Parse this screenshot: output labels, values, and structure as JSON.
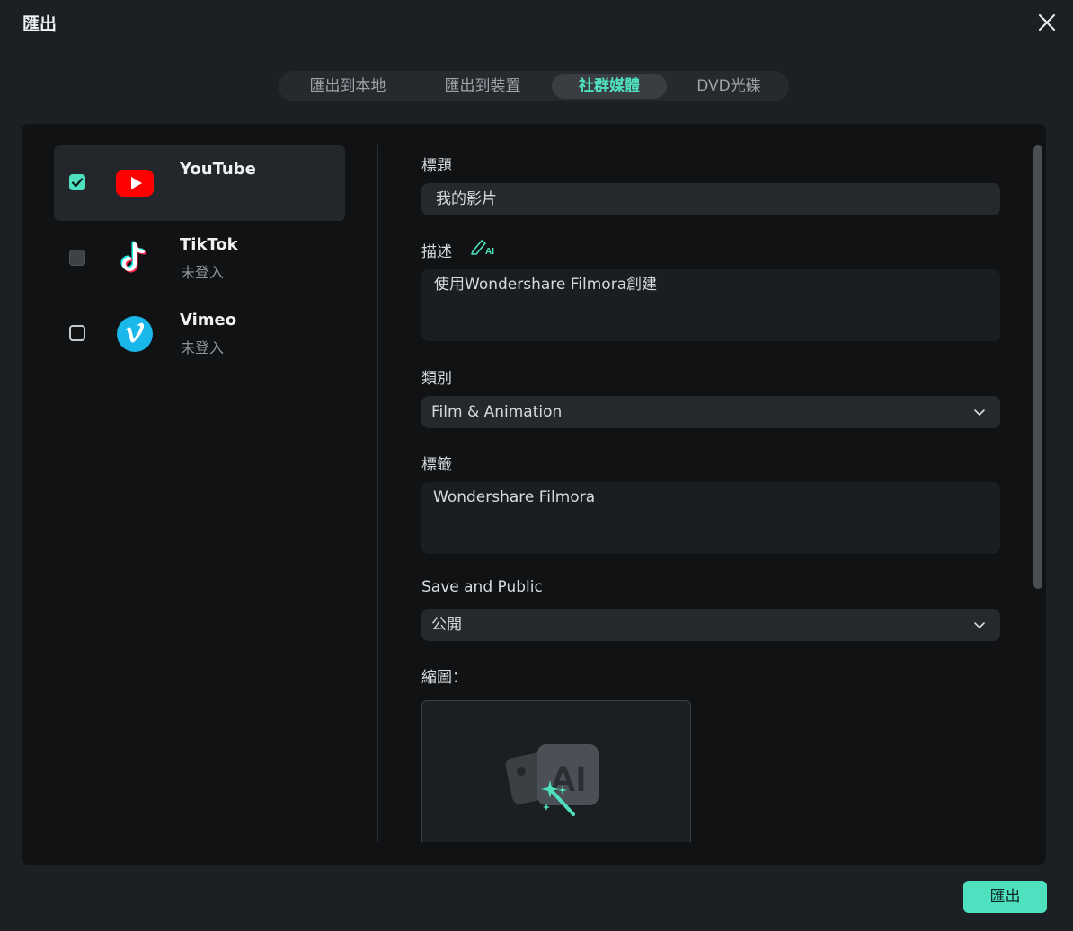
{
  "window": {
    "title": "匯出"
  },
  "tabs": [
    {
      "label": "匯出到本地",
      "active": false
    },
    {
      "label": "匯出到裝置",
      "active": false
    },
    {
      "label": "社群媒體",
      "active": true
    },
    {
      "label": "DVD光碟",
      "active": false
    }
  ],
  "platforms": [
    {
      "name": "YouTube",
      "status": "",
      "checked": true,
      "icon": "youtube-icon"
    },
    {
      "name": "TikTok",
      "status": "未登入",
      "checked": false,
      "icon": "tiktok-icon"
    },
    {
      "name": "Vimeo",
      "status": "未登入",
      "checked": false,
      "icon": "vimeo-icon"
    }
  ],
  "form": {
    "title_label": "標題",
    "title_value": "我的影片",
    "description_label": "描述",
    "description_value": "使用Wondershare Filmora創建",
    "category_label": "類別",
    "category_value": "Film & Animation",
    "tags_label": "標籤",
    "tags_value": "Wondershare Filmora",
    "privacy_label": "Save and Public",
    "privacy_value": "公開",
    "thumbnail_label": "縮圖："
  },
  "footer": {
    "export_label": "匯出"
  },
  "colors": {
    "accent": "#4fe0c0",
    "youtube_red": "#ff0000",
    "vimeo_blue": "#1ab7ea"
  }
}
